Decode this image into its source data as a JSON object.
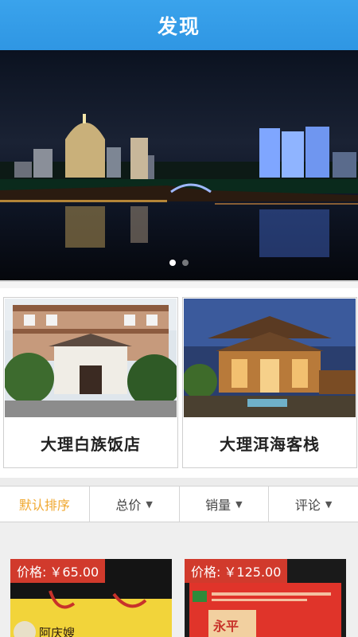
{
  "header": {
    "title": "发现"
  },
  "banner": {
    "slides": 2,
    "active": 1
  },
  "hotels": [
    {
      "name": "大理白族饭店"
    },
    {
      "name": "大理洱海客栈"
    }
  ],
  "sort": {
    "items": [
      {
        "label": "默认排序",
        "active": true,
        "arrow": ""
      },
      {
        "label": "总价",
        "active": false,
        "arrow": "down-arrow"
      },
      {
        "label": "销量",
        "active": false,
        "arrow": "down-arrow"
      },
      {
        "label": "评论",
        "active": false,
        "arrow": "down-arrow"
      }
    ]
  },
  "products": [
    {
      "price_label": "价格:",
      "price": "￥65.00",
      "brand": "阿庆嫂"
    },
    {
      "price_label": "价格:",
      "price": "￥125.00",
      "brand": "永平"
    }
  ],
  "colors": {
    "header": "#3aa3ec",
    "accent": "#f0a830",
    "price_tag": "#d13a2c"
  }
}
